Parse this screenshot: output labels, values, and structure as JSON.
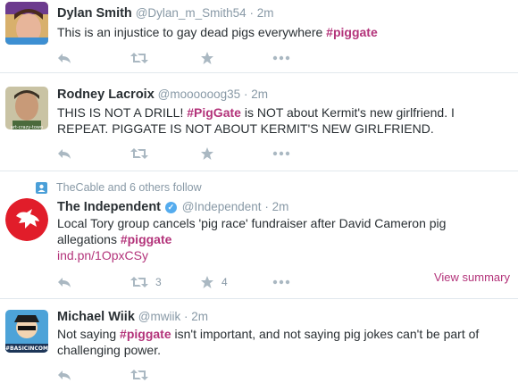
{
  "tweets": [
    {
      "name": "Dylan Smith",
      "handle": "@Dylan_m_Smith54",
      "time": "2m",
      "text_pre": "This is an injustice to gay dead pigs everywhere ",
      "hashtag": "piggate"
    },
    {
      "name": "Rodney Lacroix",
      "handle": "@moooooog35",
      "time": "2m",
      "text_a": "THIS IS NOT A DRILL! ",
      "hashtag": "PigGate",
      "text_b": " is NOT about Kermit's new girlfriend. I REPEAT. PIGGATE IS NOT ABOUT KERMIT'S NEW GIRLFRIEND."
    },
    {
      "context": "TheCable and 6 others follow",
      "name": "The Independent",
      "handle": "@Independent",
      "time": "2m",
      "text_pre": "Local Tory group cancels 'pig race' fundraiser after David Cameron pig allegations ",
      "hashtag": "piggate",
      "link": "ind.pn/1OpxCSy",
      "retweets": "3",
      "favorites": "4",
      "view_summary": "View summary"
    },
    {
      "name": "Michael Wiik",
      "handle": "@mwiik",
      "time": "2m",
      "text_a": "Not saying ",
      "hashtag": "piggate",
      "text_b": " isn't important, and not saying pig jokes can't be part of challenging power.",
      "avatar_text": "#BASICINCOME"
    }
  ],
  "separator": " · ",
  "hash": "#",
  "icons": [
    "reply-icon",
    "retweet-icon",
    "favorite-icon",
    "more-icon",
    "follow-context-icon",
    "verified-icon"
  ],
  "colors": {
    "hashtag": "#b3337a",
    "muted": "#8899a6",
    "icon": "#aab8c2",
    "verified": "#55acee"
  }
}
